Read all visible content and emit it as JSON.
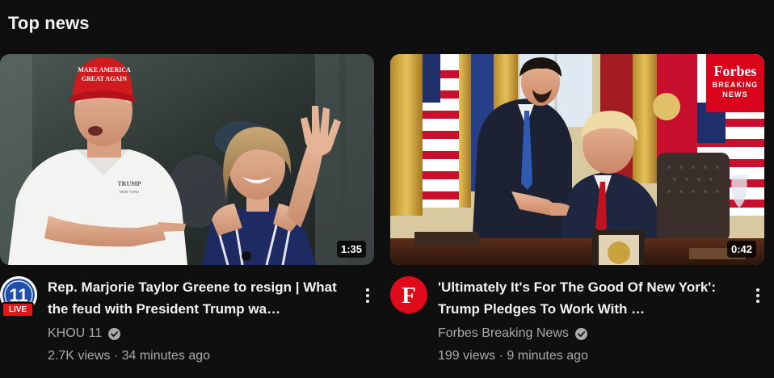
{
  "shelf": {
    "title": "Top news"
  },
  "videos": [
    {
      "duration": "1:35",
      "title": "Rep. Marjorie Taylor Greene to resign | What the feud with President Trump wa…",
      "channel": "KHOU 11",
      "verified": true,
      "views": "2.7K views",
      "age": "34 minutes ago",
      "avatar": {
        "text": "11",
        "live_label": "LIVE",
        "bg": "#1f4fa8",
        "ring": "#ffffff",
        "live_color": "#e21818"
      },
      "thumbnail": {
        "hat_text": [
          "MAKE AMERICA",
          "GREAT AGAIN"
        ],
        "shirt_text": [
          "TRUMP",
          "NEW YORK"
        ]
      }
    },
    {
      "duration": "0:42",
      "title": "'Ultimately It's For The Good Of New York': Trump Pledges To Work With …",
      "channel": "Forbes Breaking News",
      "verified": true,
      "views": "199 views",
      "age": "9 minutes ago",
      "avatar": {
        "text": "F",
        "bg": "#e10a1a"
      },
      "thumbnail": {
        "badge_brand": "Forbes",
        "badge_tag_line1": "BREAKING",
        "badge_tag_line2": "NEWS"
      }
    }
  ],
  "colors": {
    "background": "#0f0f0f",
    "primary_text": "#f1f1f1",
    "secondary_text": "#aaaaaa",
    "accent_red": "#d9041c"
  },
  "icons": {
    "menu": "kebab-menu-icon",
    "verified": "verified-check-icon"
  }
}
